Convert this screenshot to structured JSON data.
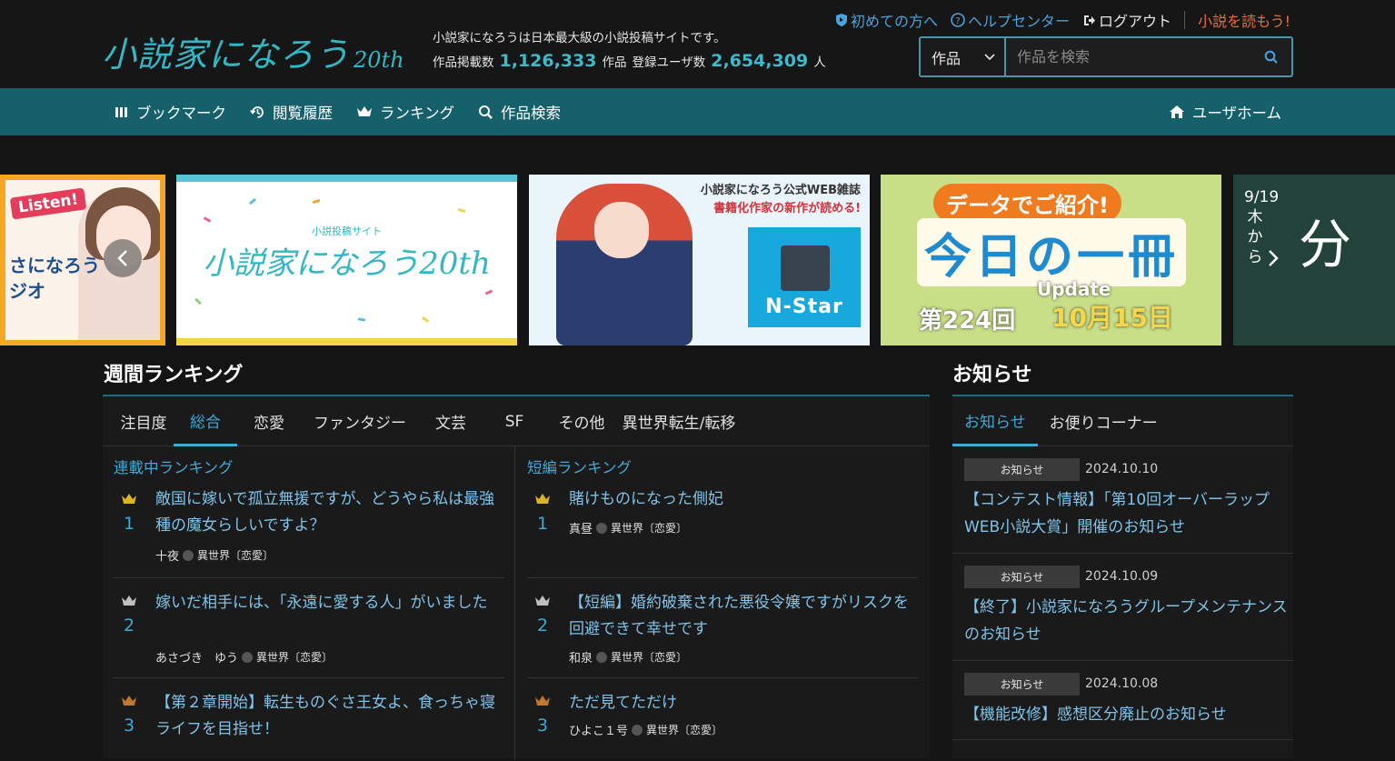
{
  "header": {
    "logo_text": "小説家になろう",
    "logo_20": "20th",
    "site_desc": "小説家になろうは日本最大級の小説投稿サイトです。",
    "works_label": "作品掲載数",
    "works_count": "1,126,333",
    "works_unit": "作品",
    "users_label": "登録ユーザ数",
    "users_count": "2,654,309",
    "users_unit": "人",
    "links": {
      "first": "初めての方へ",
      "help": "ヘルプセンター",
      "logout": "ログアウト",
      "read": "小説を読もう!"
    },
    "search": {
      "select_value": "作品",
      "placeholder": "作品を検索"
    }
  },
  "nav": {
    "bookmark": "ブックマーク",
    "history": "閲覧履歴",
    "ranking": "ランキング",
    "search": "作品検索",
    "user_home": "ユーザホーム"
  },
  "banners": {
    "b1_listen": "Listen!",
    "b1_text": "さになろう\nジオ",
    "b2_small": "小説投稿サイト",
    "b2_logo": "小説家になろう20th",
    "b3_title": "小説家になろう公式WEB雑誌",
    "b3_sub": "書籍化作家の新作が読める!",
    "b3_brand": "N-Star",
    "b4_top": "データでご紹介!",
    "b4_main": "今日の一冊",
    "b4_no": "第224回",
    "b4_update": "Update",
    "b4_date": "10月15日",
    "b5_date": "9/19木から",
    "b5_big": "分"
  },
  "ranking": {
    "title": "週間ランキング",
    "tabs": [
      "注目度",
      "総合",
      "恋愛",
      "ファンタジー",
      "文芸",
      "SF",
      "その他",
      "異世界転生/転移"
    ],
    "active_tab": 1,
    "serial_head": "連載中ランキング",
    "short_head": "短編ランキング",
    "serial": [
      {
        "rank": "1",
        "title": "敵国に嫁いで孤立無援ですが、どうやら私は最強種の魔女らしいですよ？",
        "author": "十夜",
        "genre": "異世界〔恋愛〕"
      },
      {
        "rank": "2",
        "title": "嫁いだ相手には、「永遠に愛する人」がいました",
        "author": "あさづき　ゆう",
        "genre": "異世界〔恋愛〕"
      },
      {
        "rank": "3",
        "title": "【第２章開始】転生ものぐさ王女よ、食っちゃ寝ライフを目指せ！",
        "author": "",
        "genre": ""
      }
    ],
    "short": [
      {
        "rank": "1",
        "title": "賭けものになった側妃",
        "author": "真昼",
        "genre": "異世界〔恋愛〕"
      },
      {
        "rank": "2",
        "title": "【短編】婚約破棄された悪役令嬢ですがリスクを回避できて幸せです",
        "author": "和泉",
        "genre": "異世界〔恋愛〕"
      },
      {
        "rank": "3",
        "title": "ただ見てただけ",
        "author": "ひよこ１号",
        "genre": "異世界〔恋愛〕"
      }
    ]
  },
  "notice": {
    "title": "お知らせ",
    "tabs": [
      "お知らせ",
      "お便りコーナー"
    ],
    "items": [
      {
        "badge": "お知らせ",
        "date": "2024.10.10",
        "text": "【コンテスト情報】「第10回オーバーラップWEB小説大賞」開催のお知らせ"
      },
      {
        "badge": "お知らせ",
        "date": "2024.10.09",
        "text": "【終了】小説家になろうグループメンテナンスのお知らせ"
      },
      {
        "badge": "お知らせ",
        "date": "2024.10.08",
        "text": "【機能改修】感想区分廃止のお知らせ"
      }
    ]
  },
  "colors": {
    "accent": "#3fa9d8",
    "nav_bg": "#16606c",
    "gold": "#d9b526",
    "silver": "#bfbfbf",
    "bronze": "#c0782f"
  }
}
